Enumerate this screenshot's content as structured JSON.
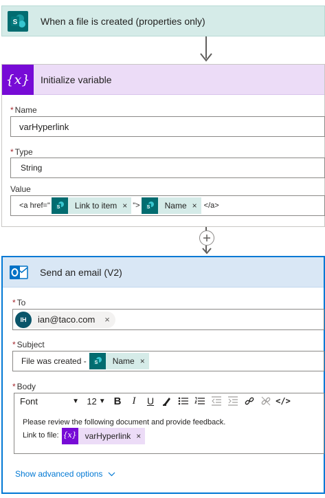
{
  "trigger": {
    "title": "When a file is created (properties only)",
    "icon": "sharepoint-icon"
  },
  "init_variable": {
    "title": "Initialize variable",
    "name_label": "Name",
    "name_value": "varHyperlink",
    "type_label": "Type",
    "type_value": "String",
    "value_label": "Value",
    "value_prefix": "<a href=\"",
    "token1_label": "Link to item",
    "value_mid": "\">",
    "token2_label": "Name",
    "value_suffix": "</a>",
    "close_glyph": "×"
  },
  "email": {
    "title": "Send an email (V2)",
    "to_label": "To",
    "to_initials": "IH",
    "to_value": "ian@taco.com",
    "subject_label": "Subject",
    "subject_prefix": "File was created -",
    "subject_token": "Name",
    "body_label": "Body",
    "font_value": "Font",
    "size_value": "12",
    "body_line1": "Please review the following document and provide feedback.",
    "body_line2_prefix": "Link to file:",
    "body_token": "varHyperlink",
    "advanced": "Show advanced options",
    "close_glyph": "×"
  },
  "colors": {
    "sharepoint": "#036c70",
    "variable": "#770bd6",
    "outlook": "#0078d4"
  }
}
